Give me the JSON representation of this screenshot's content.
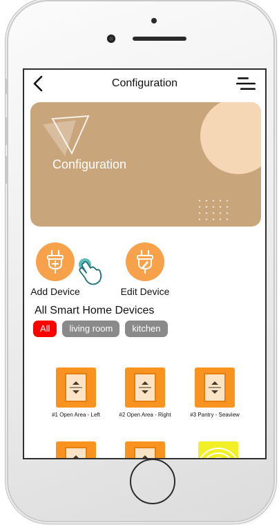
{
  "header": {
    "title": "Configuration"
  },
  "banner": {
    "title": "Configuration"
  },
  "actions": [
    {
      "label": "Add Device"
    },
    {
      "label": "Edit Device"
    }
  ],
  "devices_section": {
    "title": "All Smart Home Devices",
    "filters": [
      "All",
      "living room",
      "kitchen"
    ],
    "active_filter": "All"
  },
  "devices": [
    {
      "label": "#1 Open Area - Left"
    },
    {
      "label": "#2 Open Area - Right"
    },
    {
      "label": "#3 Pantry - Seaview"
    }
  ],
  "colors": {
    "accent_orange": "#f7931e",
    "banner": "#c9a57b",
    "active_chip": "#ff0000",
    "chip": "#8a8a8a"
  },
  "icons": [
    "back-arrow-icon",
    "hamburger-menu-icon",
    "triangle-logo-icon",
    "plug-add-icon",
    "plug-edit-icon",
    "pointing-hand-icon",
    "shutter-icon"
  ]
}
